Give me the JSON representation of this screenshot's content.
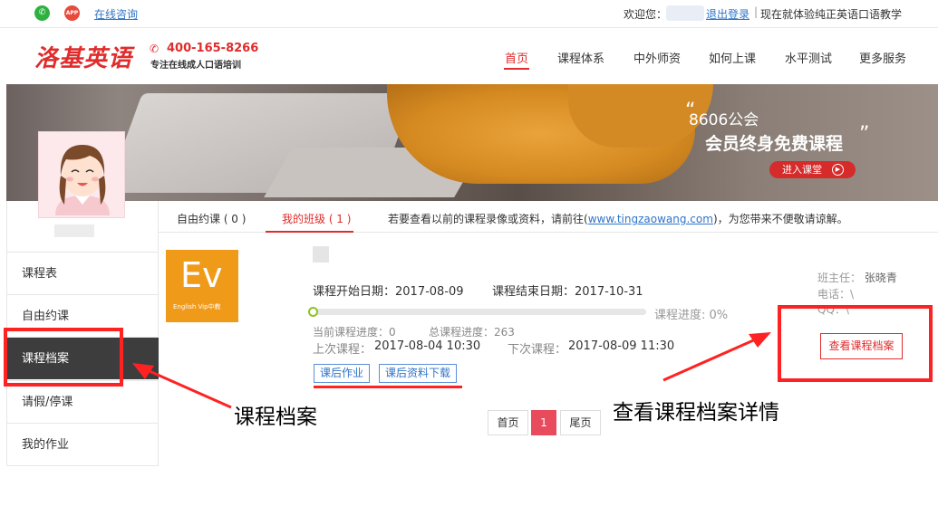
{
  "topbar": {
    "wechat_icon": "wechat-icon",
    "app_icon_label": "APP",
    "consult": "在线咨询",
    "welcome": "欢迎您：",
    "logout": "退出登录",
    "separator": "|",
    "slogan": "现在就体验纯正英语口语教学"
  },
  "header": {
    "logo": "洛基英语",
    "phone": "400-165-8266",
    "tagline": "专注在线成人口语培训",
    "nav": [
      "首页",
      "课程体系",
      "中外师资",
      "如何上课",
      "水平测试",
      "更多服务"
    ]
  },
  "banner": {
    "line1": "8606公会",
    "line2": "会员终身免费课程",
    "quote_open": "“",
    "quote_close": "”",
    "button": "进入课堂",
    "button_icon": "▶"
  },
  "sidebar": {
    "items": [
      "课程表",
      "自由约课",
      "课程档案",
      "请假/停课",
      "我的作业"
    ]
  },
  "tabs": {
    "free_booking": "自由约课 ( 0 )",
    "my_class": "我的班级 ( 1 )",
    "note_prefix": "若要查看以前的课程录像或资料，请前往(",
    "note_link": "www.tingzaowang.com",
    "note_suffix": ")，为您带来不便敬请谅解。"
  },
  "course": {
    "logo_text": "Ev",
    "logo_sub": "English Vip中教",
    "start_date": "课程开始日期：2017-08-09",
    "end_date": "课程结束日期：2017-10-31",
    "progress_label": "课程进度: 0%",
    "progress_value": 0,
    "current_progress": "当前课程进度：0",
    "total_progress": "总课程进度：263",
    "last_class_label": "上次课程：",
    "last_class": "2017-08-04 10:30",
    "next_class_label": "下次课程：",
    "next_class": "2017-08-09 11:30",
    "homework_btn": "课后作业",
    "download_btn": "课后资料下载",
    "head_teacher_label": "班主任：",
    "head_teacher": "张晓青",
    "phone": "电话：\\",
    "qq": "QQ：\\",
    "view_archive_btn": "查看课程档案"
  },
  "pagination": {
    "first": "首页",
    "current": "1",
    "last": "尾页"
  },
  "annotations": {
    "left_label": "课程档案",
    "right_label": "查看课程档案详情"
  },
  "colors": {
    "brand_red": "#e02c2c",
    "link_blue": "#2f74c8",
    "annotation_red": "#ff2222"
  }
}
